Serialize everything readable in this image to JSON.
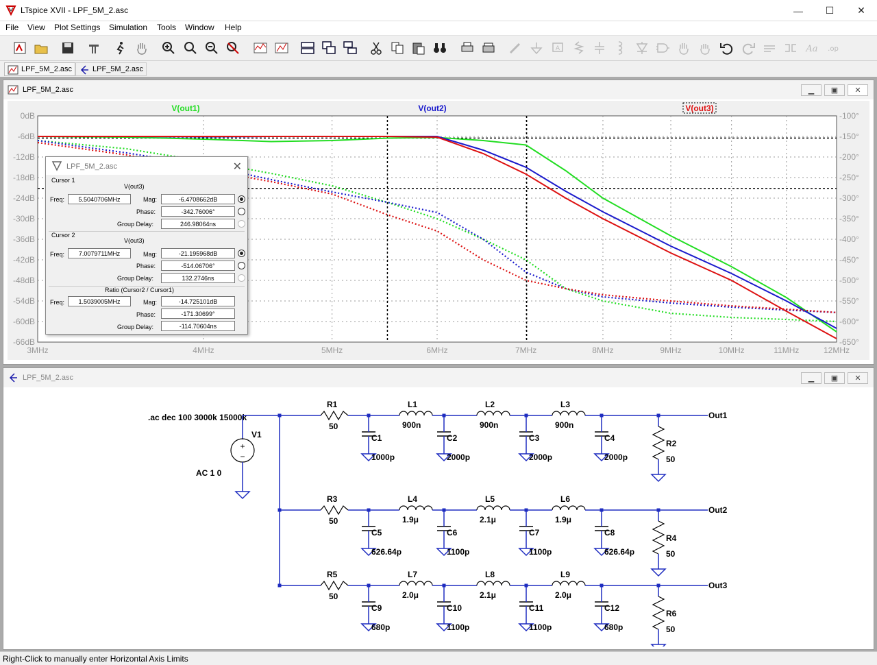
{
  "window": {
    "title": "LTspice XVII - LPF_5M_2.asc",
    "minimize": "—",
    "maximize": "☐",
    "close": "✕"
  },
  "menu": [
    "File",
    "View",
    "Plot Settings",
    "Simulation",
    "Tools",
    "Window",
    "Help"
  ],
  "tabs": [
    {
      "label": "LPF_5M_2.asc",
      "kind": "waveform"
    },
    {
      "label": "LPF_5M_2.asc",
      "kind": "schematic"
    }
  ],
  "plot_window": {
    "title": "LPF_5M_2.asc"
  },
  "schematic_window": {
    "title": "LPF_5M_2.asc"
  },
  "chart_data": {
    "type": "line",
    "title": "",
    "xlabel": "",
    "ylabel": "",
    "x_scale": "log",
    "xlim_mhz": [
      3,
      12
    ],
    "x_ticks": [
      "3MHz",
      "4MHz",
      "5MHz",
      "6MHz",
      "7MHz",
      "8MHz",
      "9MHz",
      "10MHz",
      "11MHz",
      "12MHz"
    ],
    "x_tick_values": [
      3,
      4,
      5,
      6,
      7,
      8,
      9,
      10,
      11,
      12
    ],
    "ylim_db": [
      -66,
      0
    ],
    "y_left_ticks": [
      "0dB",
      "-6dB",
      "-12dB",
      "-18dB",
      "-24dB",
      "-30dB",
      "-36dB",
      "-42dB",
      "-48dB",
      "-54dB",
      "-60dB",
      "-66dB"
    ],
    "y_left_values": [
      0,
      -6,
      -12,
      -18,
      -24,
      -30,
      -36,
      -42,
      -48,
      -54,
      -60,
      -66
    ],
    "ylim_phase": [
      -650,
      -100
    ],
    "y_right_ticks": [
      "-100°",
      "-150°",
      "-200°",
      "-250°",
      "-300°",
      "-350°",
      "-400°",
      "-450°",
      "-500°",
      "-550°",
      "-600°",
      "-650°"
    ],
    "y_right_values": [
      -100,
      -150,
      -200,
      -250,
      -300,
      -350,
      -400,
      -450,
      -500,
      -550,
      -600,
      -650
    ],
    "grid": true,
    "series": [
      {
        "name": "V(out1)",
        "color": "#22dd22",
        "x": [
          3,
          3.5,
          4,
          4.5,
          5,
          5.5,
          6,
          6.5,
          7,
          7.5,
          8,
          9,
          10,
          11,
          12
        ],
        "mag": [
          -6,
          -6.2,
          -6.8,
          -7.5,
          -7.2,
          -6.5,
          -6.3,
          -7.2,
          -8.5,
          -16,
          -24,
          -35,
          -44,
          -53,
          -63
        ],
        "phase": [
          -160,
          -180,
          -210,
          -240,
          -270,
          -310,
          -350,
          -400,
          -450,
          -520,
          -550,
          -580,
          -590,
          -595,
          -600
        ]
      },
      {
        "name": "V(out2)",
        "color": "#1a1acc",
        "x": [
          3,
          3.5,
          4,
          4.5,
          5,
          5.5,
          6,
          6.5,
          7,
          7.5,
          8,
          9,
          10,
          11,
          12
        ],
        "mag": [
          -6,
          -6,
          -6.1,
          -6,
          -6,
          -6,
          -6,
          -10,
          -15,
          -22,
          -28,
          -38,
          -46,
          -54,
          -62
        ],
        "phase": [
          -160,
          -190,
          -220,
          -255,
          -285,
          -310,
          -335,
          -400,
          -480,
          -520,
          -540,
          -555,
          -565,
          -572,
          -578
        ]
      },
      {
        "name": "V(out3)",
        "color": "#dd1111",
        "x": [
          3,
          3.5,
          4,
          4.5,
          5,
          5.5,
          6,
          6.5,
          7,
          7.5,
          8,
          9,
          10,
          11,
          12
        ],
        "mag": [
          -6,
          -6,
          -6,
          -6,
          -6,
          -6,
          -6.2,
          -11,
          -17,
          -24,
          -30,
          -40,
          -48,
          -57,
          -65
        ],
        "phase": [
          -165,
          -195,
          -230,
          -260,
          -290,
          -340,
          -380,
          -450,
          -500,
          -520,
          -535,
          -550,
          -562,
          -570,
          -578
        ]
      }
    ],
    "cursors": [
      {
        "x_mhz": 5.5040706,
        "mag_db": -6.4708662
      },
      {
        "x_mhz": 7.0079711,
        "mag_db": -21.195968
      }
    ]
  },
  "cursor_dialog": {
    "title": "LPF_5M_2.asc",
    "c1": {
      "label": "Cursor 1",
      "trace": "V(out3)",
      "freq": "5.5040706MHz",
      "mag": "-6.4708662dB",
      "phase": "-342.76006°",
      "gd": "246.98064ns"
    },
    "c2": {
      "label": "Cursor 2",
      "trace": "V(out3)",
      "freq": "7.0079711MHz",
      "mag": "-21.195968dB",
      "phase": "-514.06706°",
      "gd": "132.2746ns"
    },
    "ratio": {
      "label": "Ratio (Cursor2 / Cursor1)",
      "freq": "1.5039005MHz",
      "mag": "-14.725101dB",
      "phase": "-171.30699°",
      "gd": "-114.70604ns"
    },
    "freq_label": "Freq:",
    "mag_label": "Mag:",
    "phase_label": "Phase:",
    "gd_label": "Group Delay:"
  },
  "schematic": {
    "directive": ".ac dec 100 3000k 15000k",
    "source": {
      "name": "V1",
      "value": "AC 1 0"
    },
    "rows": [
      {
        "r": "R1",
        "rv": "50",
        "caps": [
          [
            "C1",
            "1000p"
          ],
          [
            "C2",
            "2000p"
          ],
          [
            "C3",
            "2000p"
          ],
          [
            "C4",
            "2000p"
          ]
        ],
        "inds": [
          [
            "L1",
            "900n"
          ],
          [
            "L2",
            "900n"
          ],
          [
            "L3",
            "900n"
          ]
        ],
        "rl": "R2",
        "rlv": "50",
        "out": "Out1"
      },
      {
        "r": "R3",
        "rv": "50",
        "caps": [
          [
            "C5",
            "626.64p"
          ],
          [
            "C6",
            "1100p"
          ],
          [
            "C7",
            "1100p"
          ],
          [
            "C8",
            "626.64p"
          ]
        ],
        "inds": [
          [
            "L4",
            "1.9μ"
          ],
          [
            "L5",
            "2.1μ"
          ],
          [
            "L6",
            "1.9μ"
          ]
        ],
        "rl": "R4",
        "rlv": "50",
        "out": "Out2"
      },
      {
        "r": "R5",
        "rv": "50",
        "caps": [
          [
            "C9",
            "680p"
          ],
          [
            "C10",
            "1100p"
          ],
          [
            "C11",
            "1100p"
          ],
          [
            "C12",
            "680p"
          ]
        ],
        "inds": [
          [
            "L7",
            "2.0μ"
          ],
          [
            "L8",
            "2.1μ"
          ],
          [
            "L9",
            "2.0μ"
          ]
        ],
        "rl": "R6",
        "rlv": "50",
        "out": "Out3"
      }
    ]
  },
  "status": "Right-Click to manually enter Horizontal Axis Limits"
}
